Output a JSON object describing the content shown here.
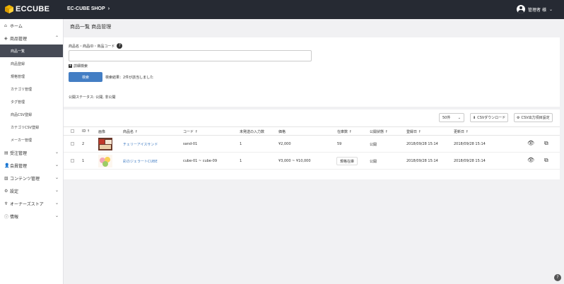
{
  "header": {
    "logo_text": "ECCUBE",
    "shop_name": "EC-CUBE SHOP",
    "shop_chevron": "›",
    "user_name": "管理者 様",
    "user_caret": "⌄"
  },
  "sidebar": {
    "items": [
      {
        "icon": "⌂",
        "label": "ホーム",
        "chevron": ""
      },
      {
        "icon": "◈",
        "label": "商品管理",
        "chevron": "⌃"
      }
    ],
    "subitems": [
      {
        "label": "商品一覧",
        "active": true
      },
      {
        "label": "商品登録",
        "active": false
      },
      {
        "label": "規格管理",
        "active": false
      },
      {
        "label": "カテゴリ管理",
        "active": false
      },
      {
        "label": "タグ管理",
        "active": false
      },
      {
        "label": "商品CSV登録",
        "active": false
      },
      {
        "label": "カテゴリCSV登録",
        "active": false
      },
      {
        "label": "メーカー管理",
        "active": false
      }
    ],
    "bottom_items": [
      {
        "icon": "▤",
        "label": "受注管理",
        "chevron": "⌄"
      },
      {
        "icon": "👤",
        "label": "会員管理",
        "chevron": "⌄"
      },
      {
        "icon": "▧",
        "label": "コンテンツ管理",
        "chevron": "⌄"
      },
      {
        "icon": "⚙",
        "label": "設定",
        "chevron": "⌄"
      },
      {
        "icon": "♆",
        "label": "オーナーズストア",
        "chevron": "⌄"
      },
      {
        "icon": "ⓘ",
        "label": "情報",
        "chevron": "⌄"
      }
    ]
  },
  "page": {
    "title": "商品一覧 商品管理"
  },
  "search": {
    "label": "商品名・商品ID・商品コード",
    "help_icon": "?",
    "input_value": "",
    "input_placeholder": "",
    "advanced_label": "詳細検索",
    "advanced_icon": "+",
    "button_label": "検索",
    "result_text": "検索結果：2件が該当しました",
    "filter_text": "公開ステータス: 公開, 非公開"
  },
  "list": {
    "per_page": "50件",
    "per_page_caret": "⌄",
    "csv_download": "CSVダウンロード",
    "csv_settings": "CSV出力項目設定",
    "columns": [
      "ID ↑",
      "画像",
      "商品名 ↑",
      "コード ↑",
      "未発送の入力数",
      "価格",
      "在庫数 ↑",
      "公開状態 ↑",
      "登録日 ↑",
      "更新日 ↑"
    ],
    "rows": [
      {
        "id": "2",
        "name": "チェリーアイスサンド",
        "code": "sand-01",
        "pending": "1",
        "price": "¥2,000",
        "stock": "59",
        "status": "公開",
        "created": "2018/09/28 15:14",
        "updated": "2018/09/28 15:14",
        "stock_button": ""
      },
      {
        "id": "1",
        "name": "彩のジェラートCUBE",
        "code": "cube-01 ~ cube-09",
        "pending": "1",
        "price": "¥3,000 ~ ¥10,000",
        "stock": "",
        "status": "公開",
        "created": "2018/09/28 15:14",
        "updated": "2018/09/28 15:14",
        "stock_button": "規格在庫"
      }
    ]
  },
  "colors": {
    "topbar": "#262a33",
    "accent": "#437ec4",
    "sidebar_active": "#464a55"
  },
  "help_fab": "?"
}
